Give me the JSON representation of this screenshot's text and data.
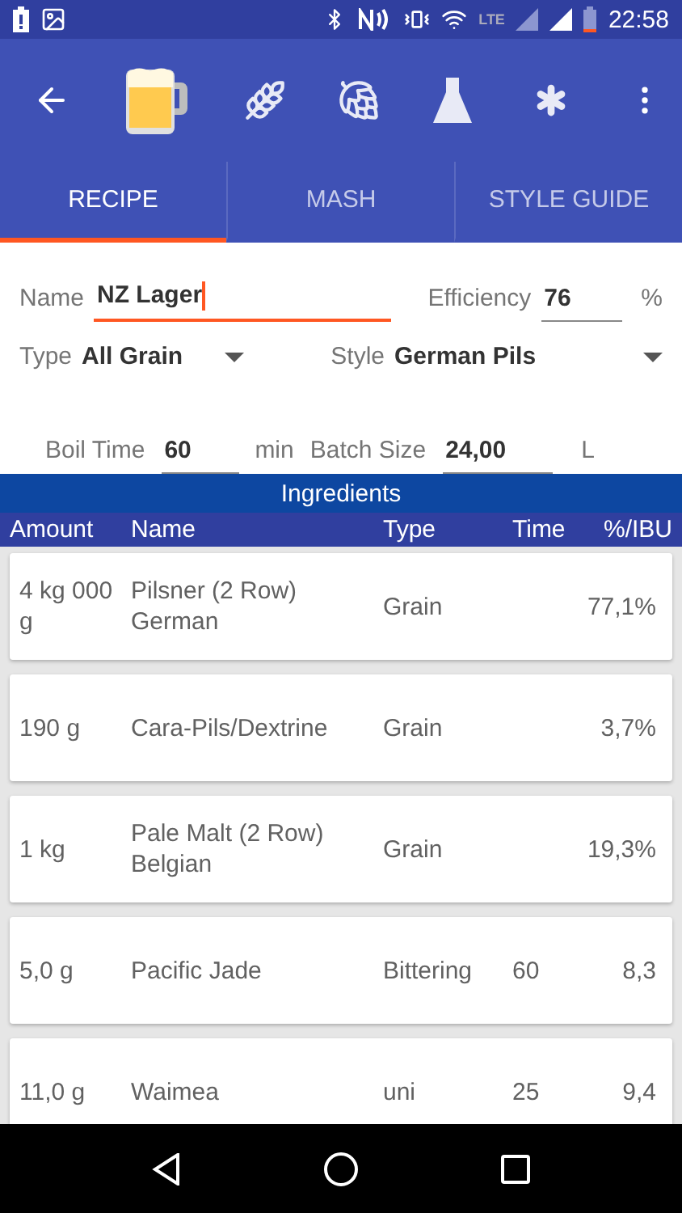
{
  "status_bar": {
    "network": "LTE",
    "time": "22:58"
  },
  "tabs": [
    {
      "label": "RECIPE",
      "selected": true
    },
    {
      "label": "MASH",
      "selected": false
    },
    {
      "label": "STYLE GUIDE",
      "selected": false
    }
  ],
  "form": {
    "name": {
      "label": "Name",
      "value": "NZ Lager",
      "focused": true
    },
    "efficiency": {
      "label": "Efficiency",
      "value": "76",
      "unit": "%"
    },
    "type": {
      "label": "Type",
      "value": "All Grain"
    },
    "style": {
      "label": "Style",
      "value": "German Pils"
    },
    "boil_time": {
      "label": "Boil Time",
      "value": "60",
      "unit": "min"
    },
    "batch_size": {
      "label": "Batch Size",
      "value": "24,00",
      "unit": "L"
    }
  },
  "ingredients": {
    "title": "Ingredients",
    "columns": [
      "Amount",
      "Name",
      "Type",
      "Time",
      "%/IBU"
    ],
    "rows": [
      {
        "amount": "4 kg 000 g",
        "name": "Pilsner (2 Row) German",
        "type": "Grain",
        "time": "",
        "share": "77,1%"
      },
      {
        "amount": "190 g",
        "name": "Cara-Pils/Dextrine",
        "type": "Grain",
        "time": "",
        "share": "3,7%"
      },
      {
        "amount": "1 kg",
        "name": "Pale Malt (2 Row) Belgian",
        "type": "Grain",
        "time": "",
        "share": "19,3%"
      },
      {
        "amount": "5,0 g",
        "name": "Pacific Jade",
        "type": "Bittering",
        "time": "60",
        "share": "8,3"
      },
      {
        "amount": "11,0 g",
        "name": "Waimea",
        "type": "uni",
        "time": "25",
        "share": "9,4"
      }
    ]
  }
}
